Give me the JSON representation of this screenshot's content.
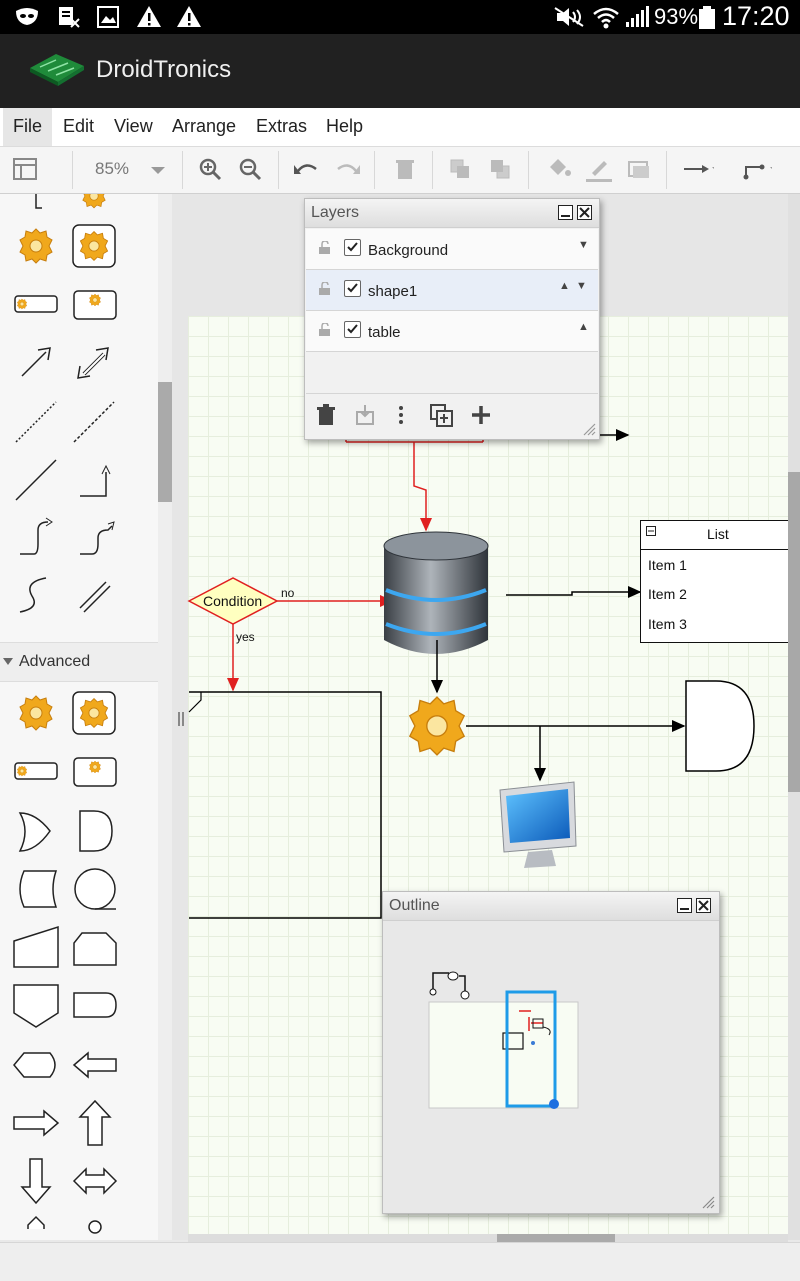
{
  "status_bar": {
    "battery": "93%",
    "time": "17:20"
  },
  "app": {
    "title": "DroidTronics"
  },
  "menu": [
    "File",
    "Edit",
    "View",
    "Arrange",
    "Extras",
    "Help"
  ],
  "toolbar": {
    "zoom": "85%"
  },
  "sidebar": {
    "section_label": "Advanced"
  },
  "layers_panel": {
    "title": "Layers",
    "layers": [
      {
        "name": "Background",
        "visible": true,
        "selected": false
      },
      {
        "name": "shape1",
        "visible": true,
        "selected": true
      },
      {
        "name": "table",
        "visible": true,
        "selected": false
      }
    ]
  },
  "outline_panel": {
    "title": "Outline"
  },
  "diagram": {
    "condition_label": "Condition",
    "no_label": "no",
    "yes_label": "yes",
    "list": {
      "title": "List",
      "items": [
        "Item 1",
        "Item 2",
        "Item 3"
      ]
    }
  },
  "colors": {
    "accent_blue": "#1e9be8",
    "edge_red": "#e02020",
    "diamond_fill": "#ffffc0"
  }
}
